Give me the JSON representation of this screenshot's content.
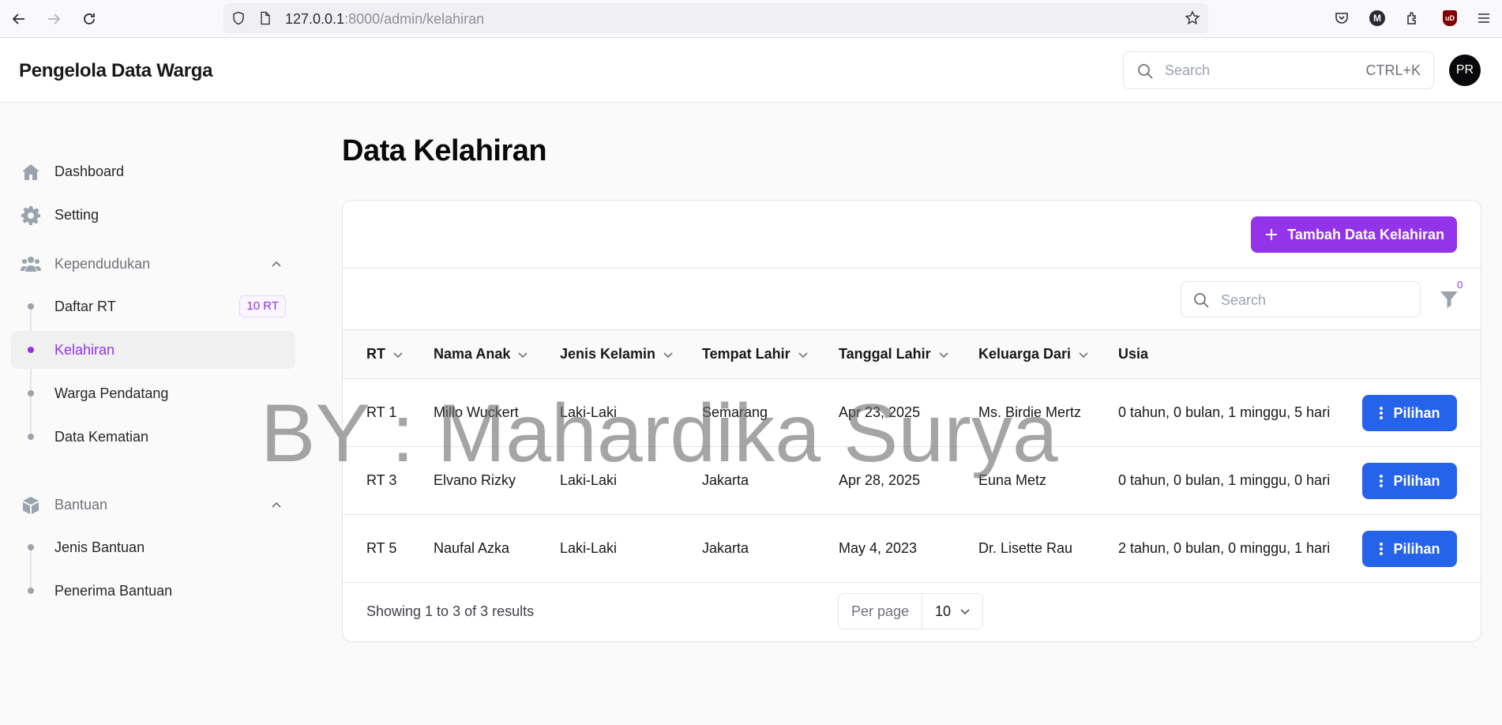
{
  "browser": {
    "url_host": "127.0.0.1",
    "url_path": ":8000/admin/kelahiran",
    "account_initial": "M",
    "ublock_label": "uD"
  },
  "app": {
    "brand": "Pengelola Data Warga",
    "search_placeholder": "Search",
    "search_shortcut": "CTRL+K",
    "user_initials": "PR"
  },
  "sidebar": {
    "top_items": [
      {
        "label": "Dashboard",
        "icon": "home-icon"
      },
      {
        "label": "Setting",
        "icon": "gear-icon"
      }
    ],
    "groups": [
      {
        "label": "Kependudukan",
        "icon": "users-icon",
        "items": [
          {
            "label": "Daftar RT",
            "badge": "10 RT"
          },
          {
            "label": "Kelahiran",
            "active": true
          },
          {
            "label": "Warga Pendatang"
          },
          {
            "label": "Data Kematian"
          }
        ]
      },
      {
        "label": "Bantuan",
        "icon": "cube-icon",
        "items": [
          {
            "label": "Jenis Bantuan"
          },
          {
            "label": "Penerima Bantuan"
          }
        ]
      }
    ]
  },
  "page": {
    "title": "Data Kelahiran",
    "add_button": "Tambah Data Kelahiran",
    "table_search_placeholder": "Search",
    "filter_count": "0"
  },
  "table": {
    "columns": [
      "RT",
      "Nama Anak",
      "Jenis Kelamin",
      "Tempat Lahir",
      "Tanggal Lahir",
      "Keluarga Dari",
      "Usia"
    ],
    "rows": [
      [
        "RT 1",
        "Millo Wuckert",
        "Laki-Laki",
        "Semarang",
        "Apr 23, 2025",
        "Ms. Birdie Mertz",
        "0 tahun, 0 bulan, 1 minggu, 5 hari"
      ],
      [
        "RT 3",
        "Elvano Rizky",
        "Laki-Laki",
        "Jakarta",
        "Apr 28, 2025",
        "Euna Metz",
        "0 tahun, 0 bulan, 1 minggu, 0 hari"
      ],
      [
        "RT 5",
        "Naufal Azka",
        "Laki-Laki",
        "Jakarta",
        "May 4, 2023",
        "Dr. Lisette Rau",
        "2 tahun, 0 bulan, 0 minggu, 1 hari"
      ]
    ],
    "row_action": "Pilihan",
    "footer_text": "Showing 1 to 3 of 3 results",
    "per_page_label": "Per page",
    "per_page_value": "10"
  },
  "watermark": "BY : Mahardika Surya",
  "colors": {
    "primary": "#9333ea",
    "action": "#2563eb"
  }
}
